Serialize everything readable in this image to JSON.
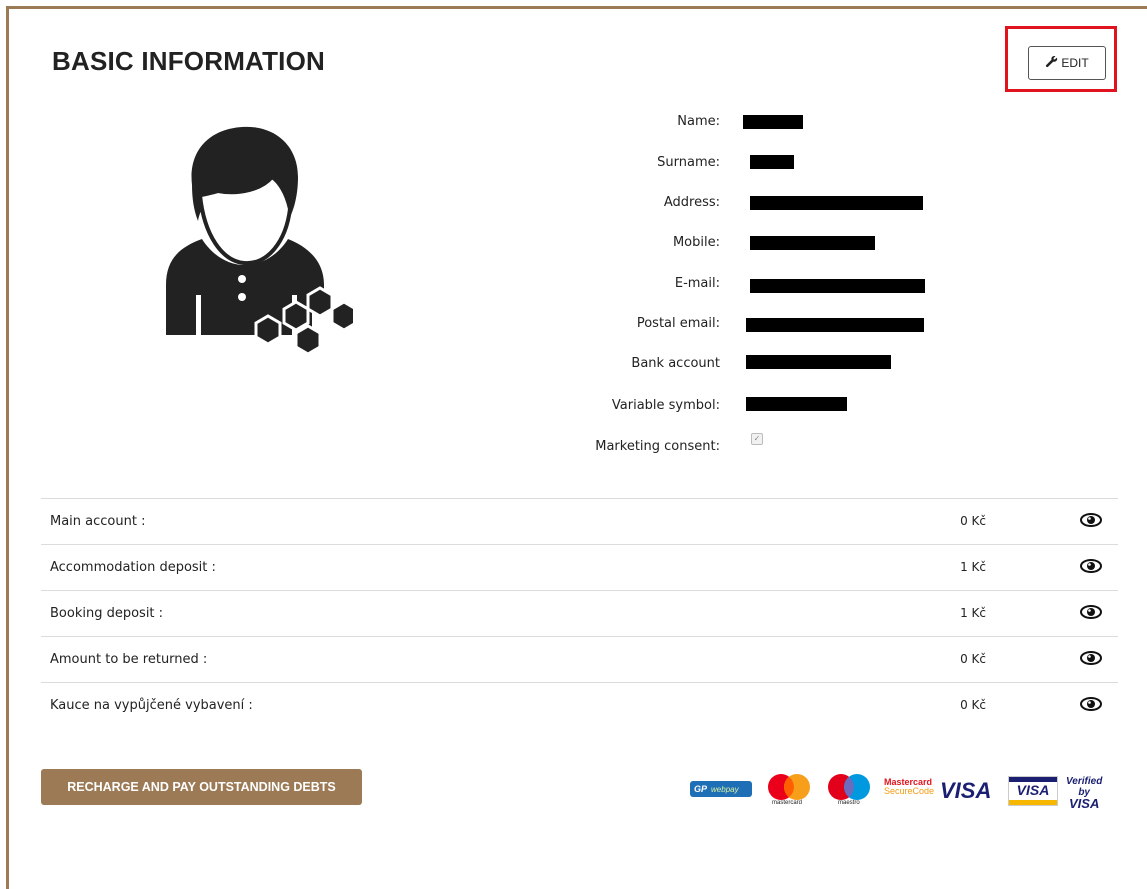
{
  "header": {
    "title": "BASIC INFORMATION",
    "edit_label": "EDIT"
  },
  "profile": {
    "fields": [
      {
        "label": "Name:"
      },
      {
        "label": "Surname:"
      },
      {
        "label": "Address:"
      },
      {
        "label": "Mobile:"
      },
      {
        "label": "E-mail:"
      },
      {
        "label": "Postal email:"
      },
      {
        "label": "Bank account"
      },
      {
        "label": "Variable symbol:"
      },
      {
        "label": "Marketing consent:"
      }
    ],
    "marketing_consent_checked": true
  },
  "accounts": [
    {
      "name": "Main account :",
      "amount": "0 Kč"
    },
    {
      "name": "Accommodation deposit :",
      "amount": "1 Kč"
    },
    {
      "name": "Booking deposit :",
      "amount": "1 Kč"
    },
    {
      "name": "Amount to be returned :",
      "amount": "0 Kč"
    },
    {
      "name": "Kauce na vypůjčené vybavení :",
      "amount": "0 Kč"
    }
  ],
  "actions": {
    "recharge_label": "RECHARGE AND PAY OUTSTANDING DEBTS"
  },
  "payment_logos": {
    "gp_label": "GP",
    "webpay_label": "webpay",
    "mastercard_label": "mastercard",
    "maestro_label": "maestro",
    "mc_secure_line1": "Mastercard",
    "mc_secure_line2": "SecureCode",
    "visa_label": "VISA",
    "visa_card_label": "VISA",
    "verified_line1": "Verified by",
    "verified_line2": "VISA"
  },
  "colors": {
    "accent_brown": "#9b7a55",
    "highlight_red": "#e0141e"
  }
}
